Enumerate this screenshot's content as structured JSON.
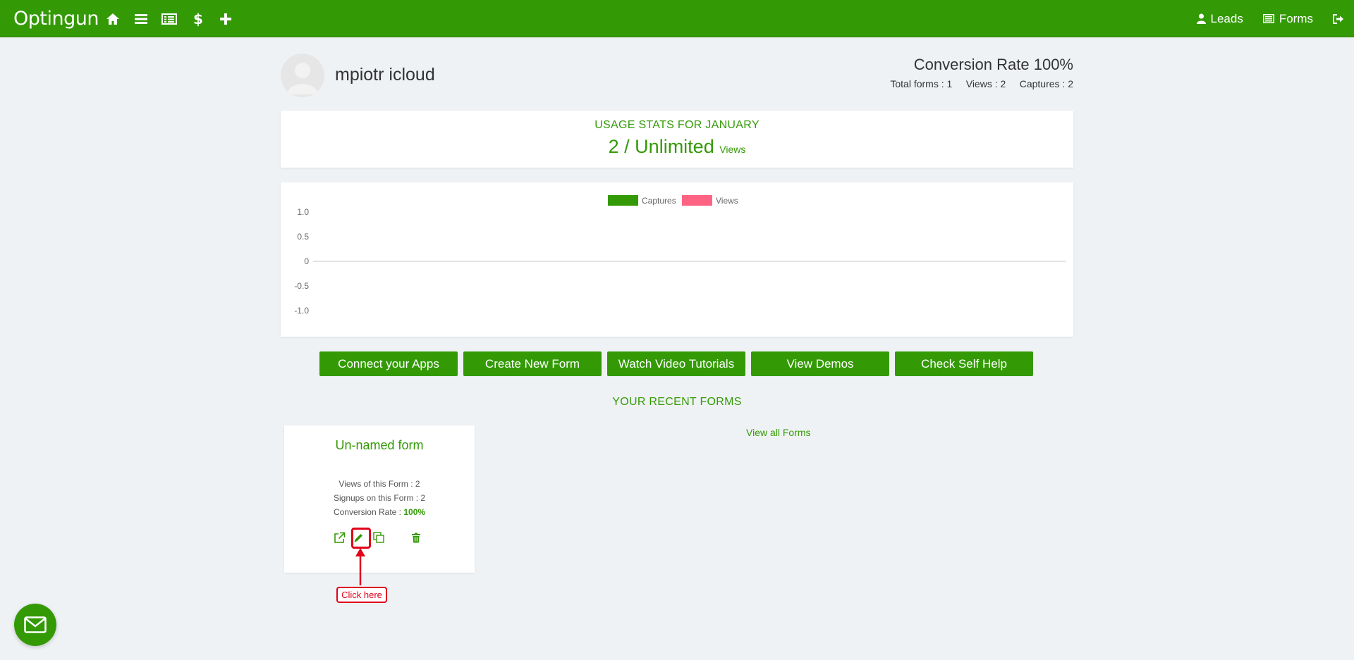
{
  "brand": {
    "name": "Optingun"
  },
  "nav": {
    "icons": [
      "home-icon",
      "list-icon",
      "forms-list-icon",
      "dollar-icon",
      "plus-icon"
    ],
    "leads_label": "Leads",
    "forms_label": "Forms"
  },
  "profile": {
    "name": "mpiotr icloud",
    "conversion_rate": "Conversion Rate 100%",
    "totals": "Total forms : 1     Views : 2     Captures : 2"
  },
  "usage": {
    "title": "USAGE STATS FOR JANUARY",
    "value": "2 / Unlimited",
    "unit": "Views"
  },
  "chart_data": {
    "type": "line",
    "series": [
      {
        "name": "Captures",
        "color": "#339a05",
        "values": []
      },
      {
        "name": "Views",
        "color": "#ff6384",
        "values": []
      }
    ],
    "y_ticks": [
      "1.0",
      "0.5",
      "0",
      "-0.5",
      "-1.0"
    ],
    "ylim": [
      -1.0,
      1.0
    ],
    "legend": "top-center"
  },
  "actions": {
    "buttons": [
      "Connect your Apps",
      "Create New Form",
      "Watch Video Tutorials",
      "View Demos",
      "Check Self Help"
    ]
  },
  "recent": {
    "title": "YOUR RECENT FORMS",
    "view_all": "View all Forms",
    "form": {
      "name": "Un-named form",
      "views": "Views of this Form : 2",
      "signups": "Signups on this Form : 2",
      "conversion_label": "Conversion Rate : ",
      "conversion_value": "100%"
    },
    "annotation": "Click here"
  },
  "colors": {
    "primary": "#339a05",
    "views": "#ff6384",
    "highlight": "#e0001a"
  }
}
